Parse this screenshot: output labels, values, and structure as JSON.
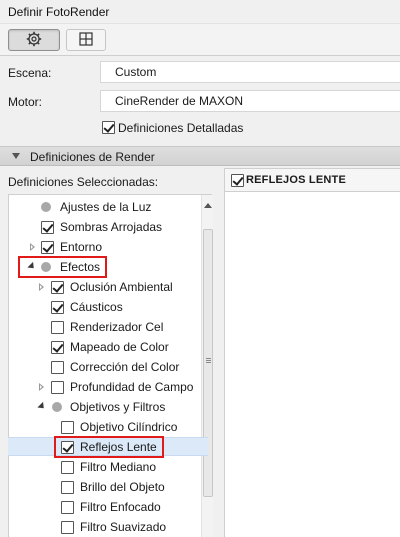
{
  "window": {
    "title": "Definir FotoRender"
  },
  "toolbar": {
    "settings_icon": "gear-icon",
    "layout_icon": "grid-icon"
  },
  "form": {
    "escena_label": "Escena:",
    "escena_value": "Custom",
    "motor_label": "Motor:",
    "motor_value": "CineRender de MAXON",
    "detalladas_label": "Definiciones Detalladas",
    "detalladas_checked": true
  },
  "section": {
    "title": "Definiciones de Render"
  },
  "selected": {
    "label": "Definiciones Seleccionadas:"
  },
  "tree": [
    {
      "label": "Ajustes de la Luz",
      "type": "dot",
      "level": 0,
      "expander": "none"
    },
    {
      "label": "Sombras Arrojadas",
      "type": "checkbox",
      "checked": true,
      "level": 0,
      "expander": "none"
    },
    {
      "label": "Entorno",
      "type": "checkbox",
      "checked": true,
      "level": 0,
      "expander": "right"
    },
    {
      "label": "Efectos",
      "type": "dot",
      "level": 0,
      "expander": "down"
    },
    {
      "label": "Oclusión Ambiental",
      "type": "checkbox",
      "checked": true,
      "level": 1,
      "expander": "right"
    },
    {
      "label": "Cáusticos",
      "type": "checkbox",
      "checked": true,
      "level": 1,
      "expander": "none"
    },
    {
      "label": "Renderizador Cel",
      "type": "checkbox",
      "checked": false,
      "level": 1,
      "expander": "none"
    },
    {
      "label": "Mapeado de Color",
      "type": "checkbox",
      "checked": true,
      "level": 1,
      "expander": "none"
    },
    {
      "label": "Corrección del Color",
      "type": "checkbox",
      "checked": false,
      "level": 1,
      "expander": "none"
    },
    {
      "label": "Profundidad de Campo",
      "type": "checkbox",
      "checked": false,
      "level": 1,
      "expander": "right"
    },
    {
      "label": "Objetivos y Filtros",
      "type": "dot",
      "level": 1,
      "expander": "down"
    },
    {
      "label": "Objetivo Cilíndrico",
      "type": "checkbox",
      "checked": false,
      "level": 2,
      "expander": "none"
    },
    {
      "label": "Reflejos Lente",
      "type": "checkbox",
      "checked": true,
      "level": 2,
      "expander": "none",
      "selected": true
    },
    {
      "label": "Filtro Mediano",
      "type": "checkbox",
      "checked": false,
      "level": 2,
      "expander": "none"
    },
    {
      "label": "Brillo del Objeto",
      "type": "checkbox",
      "checked": false,
      "level": 2,
      "expander": "none"
    },
    {
      "label": "Filtro Enfocado",
      "type": "checkbox",
      "checked": false,
      "level": 2,
      "expander": "none"
    },
    {
      "label": "Filtro Suavizado",
      "type": "checkbox",
      "checked": false,
      "level": 2,
      "expander": "none"
    }
  ],
  "detail": {
    "title": "REFLEJOS LENTE",
    "checked": true
  },
  "colors": {
    "highlight_box": "#e01919",
    "selection_bg": "#dce9f8"
  }
}
